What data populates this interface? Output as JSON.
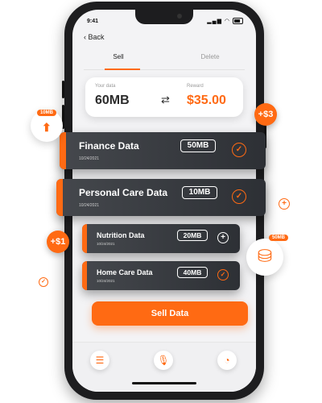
{
  "status": {
    "time": "9:41",
    "icons": "▂▄▆ ◠"
  },
  "header": {
    "back_label": "Back"
  },
  "tabs": [
    {
      "label": "Sell"
    },
    {
      "label": "Delete"
    }
  ],
  "summary": {
    "data_label": "Your data",
    "data_value": "60MB",
    "reward_label": "Reward",
    "reward_value": "$35.00",
    "swap_glyph": "⇄"
  },
  "cards": [
    {
      "title": "Finance Data",
      "date": "10/24/2021",
      "size": "50MB",
      "action": "✓"
    },
    {
      "title": "Personal Care Data",
      "date": "10/24/2021",
      "size": "10MB",
      "action": "✓"
    },
    {
      "title": "Nutrition Data",
      "date": "10/24/2021",
      "size": "20MB",
      "action": "+"
    },
    {
      "title": "Home Care Data",
      "date": "10/24/2021",
      "size": "40MB",
      "action": "✓"
    }
  ],
  "sell_button": {
    "label": "Sell Data"
  },
  "nav": [
    {
      "icon": "menu-icon",
      "glyph": "☰"
    },
    {
      "icon": "microphone-icon",
      "glyph": "🎙"
    },
    {
      "icon": "gauge-icon",
      "glyph": "◔"
    }
  ],
  "floating": {
    "upload_badge": "10MB",
    "upload_glyph": "⬆",
    "reward_plus3": "+$3",
    "reward_plus1": "+$1",
    "database_badge": "50MB",
    "database_glyph": "⛁",
    "plus_glyph": "+",
    "check_glyph": "✓"
  },
  "colors": {
    "accent": "#ff6a13",
    "card_dark": "#2d3035",
    "screen_bg": "#f3f3f5"
  }
}
